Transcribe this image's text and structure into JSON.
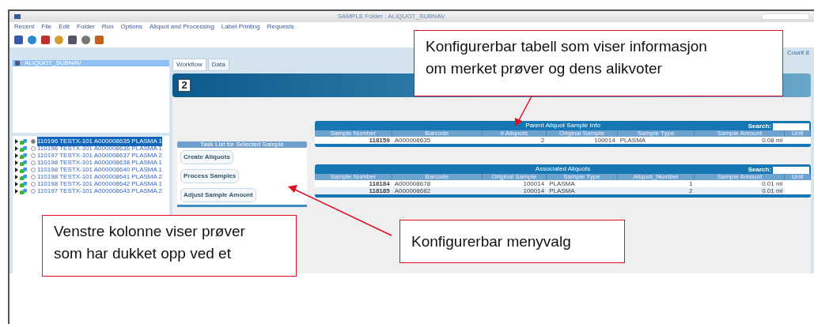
{
  "window": {
    "title": "SAMPLE Folder : ALIQUOT_SUBNAV"
  },
  "menu": [
    "Recent",
    "File",
    "Edit",
    "Folder",
    "Run",
    "Options",
    "Aliquot and Processing",
    "Label Printing",
    "Requests"
  ],
  "count": "Count 8",
  "folder_panel": {
    "title": "ALIQUOT_SUBNAV"
  },
  "sample_tree": [
    {
      "label": "110196 TESTX-101 A000008635 PLASMA 1",
      "selected": true
    },
    {
      "label": "110196 TESTX-101 A000008636 PLASMA 1",
      "selected": false
    },
    {
      "label": "110197 TESTX-101 A000008637 PLASMA 2",
      "selected": false
    },
    {
      "label": "110198 TESTX-101 A000008638 PLASMA 1",
      "selected": false
    },
    {
      "label": "110198 TESTX-101 A000008640 PLASMA 1",
      "selected": false
    },
    {
      "label": "110198 TESTX-101 A000008641 PLASMA 2",
      "selected": false
    },
    {
      "label": "110198 TESTX-101 A000008642 PLASMA 1",
      "selected": false
    },
    {
      "label": "110197 TESTX-101 A000008643 PLASMA 2",
      "selected": false
    }
  ],
  "tabs": [
    {
      "label": "Workflow",
      "selected": true
    },
    {
      "label": "Data",
      "selected": false
    }
  ],
  "step": "2",
  "task_list": {
    "title": "Task List for Selected Sample",
    "buttons": [
      "Create Aliquots",
      "Process Samples",
      "Adjust Sample Amount"
    ]
  },
  "tables": [
    {
      "title": "Parent Aliquot Sample Info",
      "search_label": "Search:",
      "columns": [
        "Sample Number",
        "Barcode",
        "# Aliquots",
        "Original Sample",
        "Sample Type",
        "Sample Amount",
        "Unit"
      ],
      "rows": [
        [
          "118159",
          "A000008635",
          "2",
          "100014",
          "PLASMA",
          "0.08 ml"
        ]
      ]
    },
    {
      "title": "Associated Aliquots",
      "search_label": "Search:",
      "columns": [
        "Sample Number",
        "Barcode",
        "Original Sample",
        "Sample Type",
        "Aliquot_Number",
        "Sample Amount",
        "Unit"
      ],
      "rows": [
        [
          "118184",
          "A000008678",
          "100014",
          "PLASMA",
          "1",
          "0.01 ml"
        ],
        [
          "118185",
          "A000008682",
          "100014",
          "PLASMA",
          "2",
          "0.01 ml"
        ]
      ]
    }
  ],
  "callouts": [
    {
      "lines": [
        "Konfigurerbar tabell som viser informasjon",
        "om merket prøver og dens alikvoter"
      ]
    },
    {
      "lines": [
        "Venstre kolonne viser prøver",
        "som har dukket opp ved et"
      ]
    },
    {
      "lines": [
        "Konfigurerbar menyvalg"
      ]
    }
  ]
}
